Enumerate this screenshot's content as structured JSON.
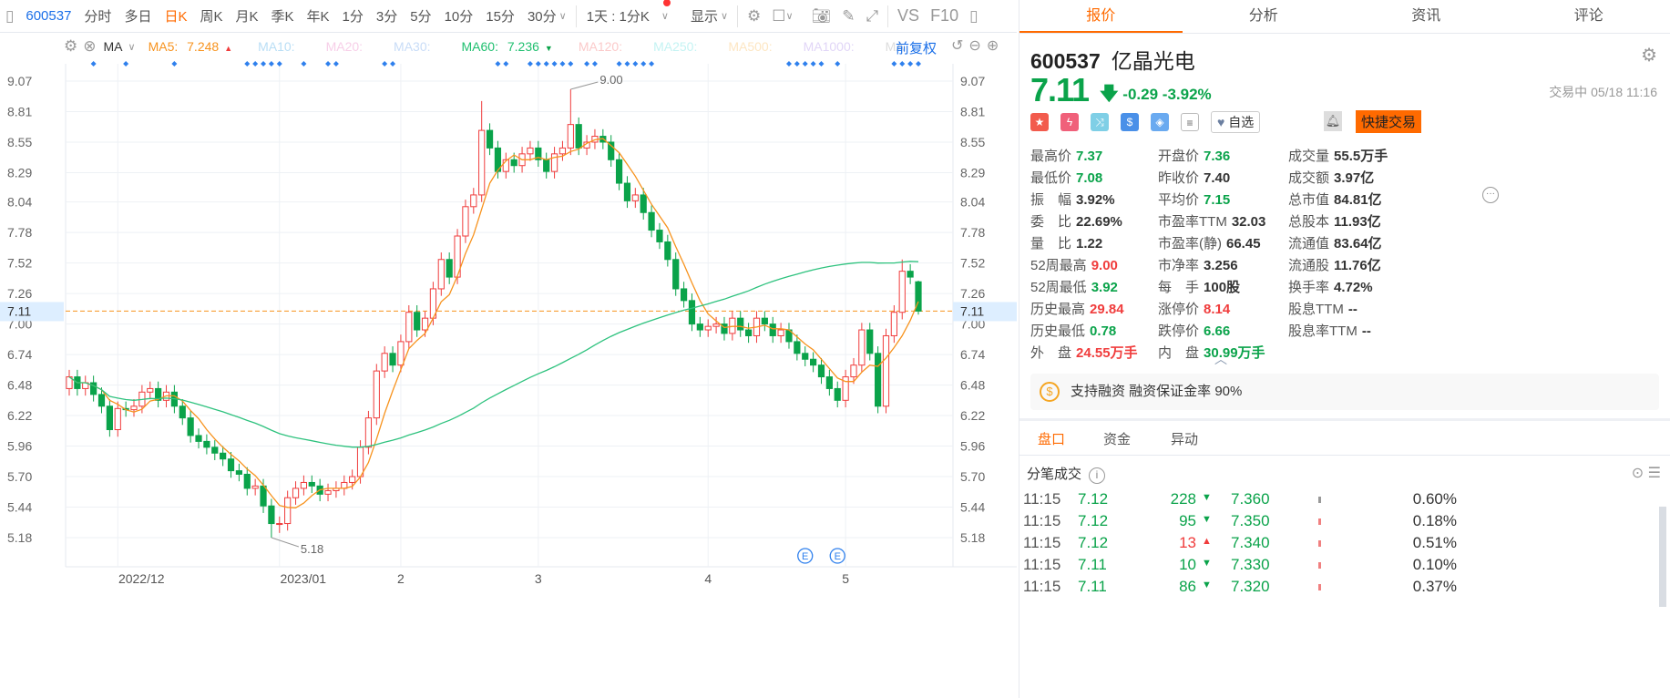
{
  "toolbar": {
    "code": "600537",
    "periods": [
      "分时",
      "多日",
      "日K",
      "周K",
      "月K",
      "季K",
      "年K",
      "1分",
      "3分",
      "5分",
      "10分",
      "15分",
      "30分"
    ],
    "active_period": "日K",
    "range": "1天 : 1分K",
    "display": "显示",
    "vs": "VS",
    "f10": "F10"
  },
  "ma": {
    "label": "MA",
    "items": [
      {
        "name": "MA5:",
        "value": "7.248",
        "color": "#f7931e",
        "dir": "up"
      },
      {
        "name": "MA10:",
        "value": "",
        "color": "#b9def5"
      },
      {
        "name": "MA20:",
        "value": "",
        "color": "#f7cfe8"
      },
      {
        "name": "MA30:",
        "value": "",
        "color": "#c8dcf7"
      },
      {
        "name": "MA60:",
        "value": "7.236",
        "color": "#1fbf6f",
        "dir": "down"
      },
      {
        "name": "MA120:",
        "value": "",
        "color": "#fbcaca"
      },
      {
        "name": "MA250:",
        "value": "",
        "color": "#c4f3f3"
      },
      {
        "name": "MA500:",
        "value": "",
        "color": "#fde6c2"
      },
      {
        "name": "MA1000:",
        "value": "",
        "color": "#e1d6f7"
      },
      {
        "name": "MA",
        "value": "",
        "color": "#ddd"
      }
    ],
    "adjust": "前复权"
  },
  "chart_data": {
    "type": "candlestick",
    "y_ticks": [
      "9.07",
      "8.81",
      "8.55",
      "8.29",
      "8.04",
      "7.78",
      "7.52",
      "7.26",
      "7.00",
      "6.74",
      "6.48",
      "6.22",
      "5.96",
      "5.70",
      "5.44",
      "5.18"
    ],
    "ylim": [
      5.18,
      9.07
    ],
    "current_price": "7.11",
    "x_labels": [
      {
        "label": "2022/12",
        "index": 6
      },
      {
        "label": "2023/01",
        "index": 26
      },
      {
        "label": "2",
        "index": 41
      },
      {
        "label": "3",
        "index": 58
      },
      {
        "label": "4",
        "index": 79
      },
      {
        "label": "5",
        "index": 96
      }
    ],
    "high_label": {
      "text": "9.00",
      "index": 62
    },
    "low_label": {
      "text": "5.18",
      "index": 25
    },
    "event_markers": [
      {
        "text": "E",
        "index": 91
      },
      {
        "text": "E",
        "index": 95
      }
    ],
    "signal_marker_indices": [
      3,
      7,
      13,
      22,
      23,
      24,
      25,
      26,
      29,
      32,
      33,
      39,
      40,
      53,
      54,
      57,
      58,
      59,
      60,
      61,
      62,
      64,
      65,
      68,
      69,
      70,
      71,
      72,
      89,
      90,
      91,
      92,
      93,
      95,
      102,
      103,
      104,
      105
    ],
    "open": [
      6.45,
      6.55,
      6.45,
      6.5,
      6.4,
      6.3,
      6.1,
      6.28,
      6.27,
      6.3,
      6.42,
      6.45,
      6.35,
      6.42,
      6.3,
      6.2,
      6.05,
      6.0,
      5.95,
      5.9,
      5.85,
      5.75,
      5.72,
      5.6,
      5.62,
      5.45,
      5.3,
      5.3,
      5.52,
      5.6,
      5.65,
      5.62,
      5.55,
      5.58,
      5.6,
      5.65,
      5.7,
      5.95,
      6.2,
      6.6,
      6.75,
      6.65,
      6.85,
      7.1,
      6.95,
      7.05,
      7.3,
      7.55,
      7.4,
      7.75,
      8.0,
      8.1,
      8.65,
      8.5,
      8.3,
      8.4,
      8.35,
      8.45,
      8.5,
      8.4,
      8.3,
      8.45,
      8.5,
      8.7,
      8.5,
      8.55,
      8.6,
      8.55,
      8.4,
      8.2,
      8.05,
      8.1,
      7.95,
      7.8,
      7.7,
      7.55,
      7.3,
      7.2,
      7.0,
      6.95,
      6.98,
      7.0,
      6.92,
      7.05,
      6.95,
      6.9,
      7.05,
      7.0,
      6.9,
      6.95,
      6.85,
      6.75,
      6.7,
      6.65,
      6.55,
      6.45,
      6.35,
      6.55,
      6.65,
      6.95,
      6.75,
      6.3,
      6.9,
      7.1,
      7.45,
      7.36
    ],
    "high": [
      6.61,
      6.61,
      6.56,
      6.56,
      6.46,
      6.36,
      6.34,
      6.34,
      6.36,
      6.48,
      6.51,
      6.51,
      6.48,
      6.48,
      6.36,
      6.26,
      6.11,
      6.06,
      6.01,
      5.96,
      5.91,
      5.81,
      5.78,
      5.68,
      5.68,
      5.51,
      5.36,
      5.58,
      5.66,
      5.71,
      5.71,
      5.68,
      5.64,
      5.66,
      5.71,
      5.76,
      6.01,
      6.26,
      6.66,
      6.81,
      6.81,
      6.91,
      7.16,
      7.16,
      7.11,
      7.36,
      7.61,
      7.61,
      7.81,
      8.06,
      8.16,
      8.9,
      8.71,
      8.56,
      8.46,
      8.46,
      8.51,
      8.56,
      8.56,
      8.46,
      8.51,
      8.56,
      9.0,
      8.76,
      8.61,
      8.66,
      8.66,
      8.61,
      8.46,
      8.26,
      8.16,
      8.16,
      8.01,
      7.86,
      7.76,
      7.61,
      7.36,
      7.26,
      7.06,
      7.04,
      7.06,
      7.06,
      7.11,
      7.11,
      7.01,
      7.11,
      7.11,
      7.06,
      7.01,
      7.01,
      6.91,
      6.81,
      6.76,
      6.71,
      6.61,
      6.51,
      6.61,
      6.71,
      7.01,
      7.01,
      6.81,
      6.96,
      7.16,
      7.55,
      7.51,
      7.37
    ],
    "low": [
      6.39,
      6.39,
      6.39,
      6.34,
      6.24,
      6.04,
      6.04,
      6.21,
      6.21,
      6.24,
      6.36,
      6.29,
      6.29,
      6.24,
      6.14,
      5.99,
      5.94,
      5.89,
      5.84,
      5.79,
      5.69,
      5.66,
      5.54,
      5.54,
      5.39,
      5.18,
      5.22,
      5.24,
      5.46,
      5.54,
      5.56,
      5.49,
      5.49,
      5.52,
      5.54,
      5.59,
      5.64,
      5.89,
      6.14,
      6.54,
      6.59,
      6.59,
      6.79,
      6.89,
      6.89,
      6.99,
      7.24,
      7.34,
      7.34,
      7.69,
      7.94,
      8.04,
      8.44,
      8.24,
      8.24,
      8.29,
      8.29,
      8.39,
      8.34,
      8.24,
      8.24,
      8.39,
      8.44,
      8.44,
      8.44,
      8.49,
      8.49,
      8.34,
      8.14,
      7.99,
      7.99,
      7.89,
      7.74,
      7.64,
      7.49,
      7.24,
      7.14,
      6.94,
      6.89,
      6.89,
      6.92,
      6.86,
      6.86,
      6.89,
      6.84,
      6.84,
      6.94,
      6.84,
      6.84,
      6.79,
      6.69,
      6.64,
      6.59,
      6.49,
      6.39,
      6.29,
      6.29,
      6.49,
      6.59,
      6.69,
      6.24,
      6.24,
      6.84,
      7.04,
      7.34,
      7.08
    ],
    "close": [
      6.55,
      6.45,
      6.5,
      6.4,
      6.3,
      6.1,
      6.28,
      6.27,
      6.3,
      6.42,
      6.45,
      6.35,
      6.42,
      6.3,
      6.2,
      6.05,
      6.0,
      5.95,
      5.9,
      5.85,
      5.75,
      5.72,
      5.6,
      5.62,
      5.45,
      5.3,
      5.3,
      5.52,
      5.6,
      5.65,
      5.62,
      5.55,
      5.58,
      5.6,
      5.65,
      5.7,
      5.95,
      6.2,
      6.6,
      6.75,
      6.65,
      6.85,
      7.1,
      6.95,
      7.05,
      7.3,
      7.55,
      7.4,
      7.75,
      8.0,
      8.1,
      8.65,
      8.5,
      8.3,
      8.4,
      8.35,
      8.45,
      8.5,
      8.4,
      8.3,
      8.45,
      8.5,
      8.7,
      8.5,
      8.55,
      8.6,
      8.55,
      8.4,
      8.2,
      8.05,
      8.1,
      7.95,
      7.8,
      7.7,
      7.55,
      7.3,
      7.2,
      7.0,
      6.95,
      6.98,
      7.0,
      6.92,
      7.05,
      6.95,
      6.9,
      7.05,
      7.0,
      6.9,
      6.95,
      6.85,
      6.75,
      6.7,
      6.65,
      6.55,
      6.45,
      6.35,
      6.55,
      6.65,
      6.95,
      6.75,
      6.3,
      6.9,
      7.1,
      7.45,
      7.4,
      7.11
    ],
    "up_color": "#f03c3c",
    "down_color": "#0aa34a",
    "ma5_color": "#f7931e",
    "ma60_color": "#2ec27e"
  },
  "tabs": [
    "报价",
    "分析",
    "资讯",
    "评论"
  ],
  "quote": {
    "code": "600537",
    "name": "亿晶光电",
    "price": "7.11",
    "change": "-0.29",
    "change_pct": "-3.92%",
    "status": "交易中 05/18 11:16",
    "watch": "自选",
    "trade": "快捷交易",
    "stats": [
      [
        {
          "l": "最高价",
          "v": "7.37",
          "c": "g"
        },
        {
          "l": "开盘价",
          "v": "7.36",
          "c": "g"
        },
        {
          "l": "成交量",
          "v": "55.5万手",
          "c": "k"
        }
      ],
      [
        {
          "l": "最低价",
          "v": "7.08",
          "c": "g"
        },
        {
          "l": "昨收价",
          "v": "7.40",
          "c": "k"
        },
        {
          "l": "成交额",
          "v": "3.97亿",
          "c": "k"
        }
      ],
      [
        {
          "l": "振　幅",
          "v": "3.92%",
          "c": "k"
        },
        {
          "l": "平均价",
          "v": "7.15",
          "c": "g"
        },
        {
          "l": "总市值",
          "v": "84.81亿",
          "c": "k"
        }
      ],
      [
        {
          "l": "委　比",
          "v": "22.69%",
          "c": "k"
        },
        {
          "l": "市盈率TTM",
          "v": "32.03",
          "c": "k"
        },
        {
          "l": "总股本",
          "v": "11.93亿",
          "c": "k"
        }
      ],
      [
        {
          "l": "量　比",
          "v": "1.22",
          "c": "k"
        },
        {
          "l": "市盈率(静)",
          "v": "66.45",
          "c": "k"
        },
        {
          "l": "流通值",
          "v": "83.64亿",
          "c": "k"
        }
      ],
      [
        {
          "l": "52周最高",
          "v": "9.00",
          "c": "r"
        },
        {
          "l": "市净率",
          "v": "3.256",
          "c": "k"
        },
        {
          "l": "流通股",
          "v": "11.76亿",
          "c": "k"
        }
      ],
      [
        {
          "l": "52周最低",
          "v": "3.92",
          "c": "g"
        },
        {
          "l": "每　手",
          "v": "100股",
          "c": "k"
        },
        {
          "l": "换手率",
          "v": "4.72%",
          "c": "k"
        }
      ],
      [
        {
          "l": "历史最高",
          "v": "29.84",
          "c": "r"
        },
        {
          "l": "涨停价",
          "v": "8.14",
          "c": "r"
        },
        {
          "l": "股息TTM",
          "v": "--",
          "c": "k"
        }
      ],
      [
        {
          "l": "历史最低",
          "v": "0.78",
          "c": "g"
        },
        {
          "l": "跌停价",
          "v": "6.66",
          "c": "g"
        },
        {
          "l": "股息率TTM",
          "v": "--",
          "c": "k"
        }
      ],
      [
        {
          "l": "外　盘",
          "v": "24.55万手",
          "c": "r"
        },
        {
          "l": "内　盘",
          "v": "30.99万手",
          "c": "g"
        }
      ]
    ],
    "margin": "支持融资 融资保证金率 90%"
  },
  "subtabs": [
    "盘口",
    "资金",
    "异动"
  ],
  "ticks": {
    "title": "分笔成交",
    "rows": [
      {
        "time": "11:15",
        "price": "7.12",
        "vol": "228",
        "dir": "down",
        "avg": "7.360",
        "pct": "0.60%"
      },
      {
        "time": "11:15",
        "price": "7.12",
        "vol": "95",
        "dir": "down",
        "avg": "7.350",
        "pct": "0.18%"
      },
      {
        "time": "11:15",
        "price": "7.12",
        "vol": "13",
        "dir": "up",
        "avg": "7.340",
        "pct": "0.51%"
      },
      {
        "time": "11:15",
        "price": "7.11",
        "vol": "10",
        "dir": "down",
        "avg": "7.330",
        "pct": "0.10%"
      },
      {
        "time": "11:15",
        "price": "7.11",
        "vol": "86",
        "dir": "down",
        "avg": "7.320",
        "pct": "0.37%"
      }
    ]
  }
}
